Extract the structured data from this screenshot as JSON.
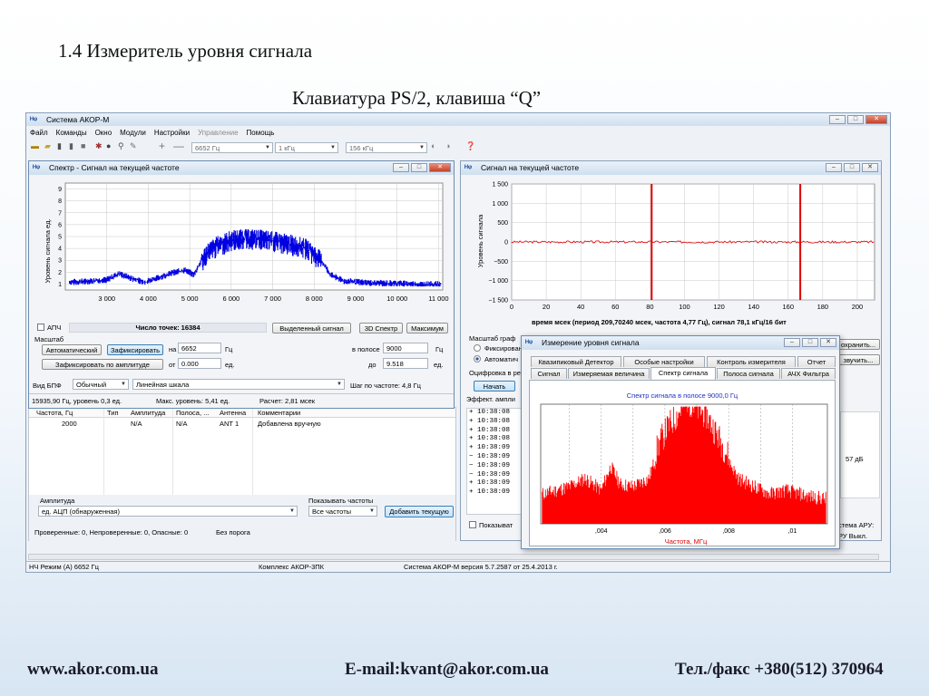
{
  "slide": {
    "title": "1.4 Измеритель уровня сигнала",
    "subtitle": "Клавиатура PS/2, клавиша “Q”",
    "footer_web": "www.akor.com.ua",
    "footer_email": "E-mail:kvant@akor.com.ua",
    "footer_phone": "Тел./факс +380(512) 370964"
  },
  "app": {
    "title": "Система АКОР-М",
    "menu": [
      "Файл",
      "Команды",
      "Окно",
      "Модули",
      "Настройки",
      "Управление",
      "Помощь"
    ],
    "toolbar": {
      "freq": "6652 Гц",
      "step": "1 кГц",
      "band": "156 кГц"
    },
    "status": {
      "mode": "НЧ Режим (А)  6652 Гц",
      "complex": "Комплекс АКОР-3ПК",
      "version": "Система АКОР-М версия 5.7.2587 от 25.4.2013 г."
    }
  },
  "spectrum": {
    "title": "Спектр - Сигнал на текущей частоте",
    "ylabel": "Уровень сигнала ед.",
    "afc_label": "АПЧ",
    "points_label": "Число точек: 16384",
    "btn_selected": "Выделенный сигнал",
    "btn_3d": "3D Спектр",
    "btn_max": "Максимум",
    "scale_label": "Масштаб",
    "btn_auto": "Автоматический",
    "btn_fixed": "Зафиксировать",
    "btn_fix_amp": "Зафиксировать по амплитуде",
    "lbl_on": "на",
    "val_on": "6652",
    "unit_hz": "Гц",
    "lbl_from": "от",
    "val_from": "0.000",
    "unit_ed": "ед.",
    "lbl_band": "в полосе",
    "val_band": "9000",
    "lbl_to": "до",
    "val_to": "9.518",
    "lbl_fft": "Вид БПФ",
    "fft_type": "Обычный",
    "scale_type": "Линейная шкала",
    "step_info": "Шаг по частоте: 4,8 Гц",
    "info_freq": "15935,90 Гц, уровень 0,3 ед.",
    "info_max": "Макс. уровень: 5,41 ед.",
    "info_calc": "Расчет: 2,81 мсек"
  },
  "table": {
    "headers": [
      "Частота, Гц",
      "Тип",
      "Амплитуда",
      "Полоса, ...",
      "Антенна",
      "Комментарии"
    ],
    "row": [
      "2000",
      "",
      "N/A",
      "N/A",
      "ANT 1",
      "Добавлена вручную"
    ],
    "amp_label": "Амплитуда",
    "amp_value": "ед. АЦП (обнаруженная)",
    "show_freq_label": "Показывать частоты",
    "show_freq_value": "Все частоты",
    "add_btn": "Добавить текущую",
    "bottom_status": "Проверенные: 0, Непроверенные: 0, Опасные: 0",
    "threshold": "Без порога"
  },
  "waveform": {
    "title": "Сигнал на текущей частоте",
    "ylabel": "Уровень сигнала",
    "caption": "время мсек (период 209,70240 мсек, частота 4,77 Гц), сигнал 78,1 кГц/16 бит",
    "scale_label": "Масштаб граф",
    "radio_fixed": "Фиксирован",
    "radio_auto": "Автоматич",
    "digit_label": "Оцифровка в ре",
    "start_btn": "Начать",
    "effect_label": "Эффект. ампли",
    "save_btn": "охранить...",
    "view_btn": "звучить...",
    "log_time": "10:38:08",
    "show_label": "Показыват",
    "side_val": "57 дБ",
    "aru_label": "стема АРУ:",
    "aru_val": "РУ Выкл."
  },
  "level": {
    "title": "Измерение уровня сигнала",
    "tabs_row1": [
      "Квазипиковый Детектор",
      "Особые настройки",
      "Контроль измерителя",
      "Отчет"
    ],
    "tabs_row2": [
      "Сигнал",
      "Измеряемая величина",
      "Спектр сигнала",
      "Полоса сигнала",
      "АЧХ Фильтра"
    ],
    "chart_title": "Спектр сигнала в полосе 9000,0 Гц",
    "xlabel": "Частота, МГц"
  },
  "chart_data": [
    {
      "type": "area",
      "title": "",
      "ylabel": "Уровень сигнала ед.",
      "xlabel": "",
      "x_ticks": [
        "3 000",
        "4 000",
        "5 000",
        "6 000",
        "7 000",
        "8 000",
        "9 000",
        "10 000",
        "11 000"
      ],
      "y_ticks": [
        1,
        2,
        3,
        4,
        5,
        6,
        7,
        8,
        9
      ],
      "xlim": [
        2000,
        11100
      ],
      "ylim": [
        0.5,
        9.5
      ],
      "series": [
        {
          "color": "#0000e0",
          "x": [
            2200,
            2700,
            3000,
            3300,
            3600,
            3900,
            4200,
            4600,
            4900,
            5100,
            5400,
            5700,
            6000,
            6300,
            6600,
            6900,
            7200,
            7500,
            7800,
            8100,
            8400,
            8700,
            9000,
            9500,
            10000,
            10500,
            11000
          ],
          "values": [
            1.2,
            1.3,
            1.4,
            1.9,
            1.5,
            1.2,
            1.5,
            2.0,
            2.2,
            1.8,
            3.8,
            4.5,
            4.9,
            5.1,
            5.0,
            4.9,
            4.7,
            4.5,
            4.2,
            3.4,
            1.8,
            1.3,
            1.2,
            1.1,
            1.1,
            1.0,
            1.0
          ]
        }
      ],
      "grid": true
    },
    {
      "type": "line",
      "title": "",
      "ylabel": "Уровень сигнала",
      "xlabel": "время мсек (период 209,70240 мсек, частота 4,77 Гц), сигнал 78,1 кГц/16 бит",
      "x_ticks": [
        "0",
        "20",
        "40",
        "60",
        "80",
        "100",
        "120",
        "140",
        "160",
        "180",
        "200"
      ],
      "y_ticks": [
        "1 500",
        "1 000",
        "500",
        "0",
        "−500",
        "−1 000",
        "−1 500"
      ],
      "xlim": [
        0,
        210
      ],
      "ylim": [
        -1500,
        1500
      ],
      "series": [
        {
          "color": "#e00000",
          "baseline": 0,
          "spikes": [
            {
              "x": 81,
              "min": -1500,
              "max": 1500
            },
            {
              "x": 167,
              "min": -1500,
              "max": 1500
            }
          ]
        }
      ],
      "grid": true
    },
    {
      "type": "area",
      "title": "Спектр сигнала в полосе 9000,0 Гц",
      "xlabel": "Частота, МГц",
      "x_ticks": [
        ",004",
        ",006",
        ",008",
        ",01"
      ],
      "xlim": [
        0.0021,
        0.0111
      ],
      "series": [
        {
          "color": "#ff0000",
          "x": [
            0.0022,
            0.003,
            0.0035,
            0.004,
            0.0043,
            0.0046,
            0.005,
            0.0055,
            0.0058,
            0.0061,
            0.0064,
            0.0067,
            0.007,
            0.0073,
            0.0076,
            0.0079,
            0.0083,
            0.0088,
            0.0093,
            0.0098,
            0.0105,
            0.011
          ],
          "values": [
            0.22,
            0.28,
            0.35,
            0.25,
            0.45,
            0.3,
            0.28,
            0.35,
            0.6,
            0.75,
            0.85,
            0.98,
            0.9,
            0.85,
            0.7,
            0.55,
            0.35,
            0.28,
            0.22,
            0.25,
            0.2,
            0.18
          ]
        }
      ],
      "grid": true
    }
  ]
}
